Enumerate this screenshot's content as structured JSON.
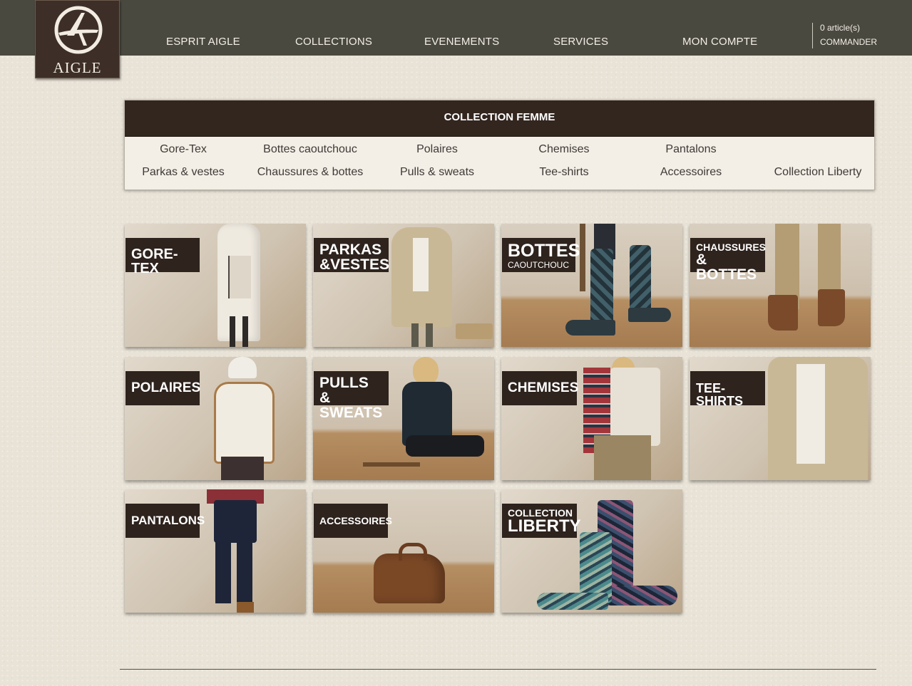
{
  "brand": {
    "name": "AIGLE",
    "colors": {
      "topbar": "#4a4940",
      "logo_bg": "#3d2f27",
      "label_bg": "#2e231d",
      "page_bg": "#e9e3d7"
    }
  },
  "nav": {
    "items": [
      "ESPRIT AIGLE",
      "COLLECTIONS",
      "EVENEMENTS",
      "SERVICES",
      "MON COMPTE"
    ],
    "cart_count": "0 article(s)",
    "cart_link": "COMMANDER"
  },
  "collection": {
    "title": "COLLECTION FEMME",
    "links_row1": [
      "Gore-Tex",
      "Bottes caoutchouc",
      "Polaires",
      "Chemises",
      "Pantalons"
    ],
    "links_row2": [
      "Parkas & vestes",
      "Chaussures & bottes",
      "Pulls & sweats",
      "Tee-shirts",
      "Accessoires",
      "Collection Liberty"
    ]
  },
  "tiles": [
    {
      "line1": "GORE-TEX",
      "line2": ""
    },
    {
      "line1": "PARKAS",
      "line2": "&VESTES"
    },
    {
      "line1": "BOTTES",
      "line2": "CAOUTCHOUC"
    },
    {
      "line1": "CHAUSSURES",
      "line2": "& BOTTES"
    },
    {
      "line1": "POLAIRES",
      "line2": ""
    },
    {
      "line1": "PULLS &",
      "line2": "SWEATS"
    },
    {
      "line1": "CHEMISES",
      "line2": ""
    },
    {
      "line1": "TEE-SHIRTS",
      "line2": ""
    },
    {
      "line1": "PANTALONS",
      "line2": ""
    },
    {
      "line1": "ACCESSOIRES",
      "line2": ""
    },
    {
      "line1": "COLLECTION",
      "line2": "LIBERTY"
    }
  ]
}
